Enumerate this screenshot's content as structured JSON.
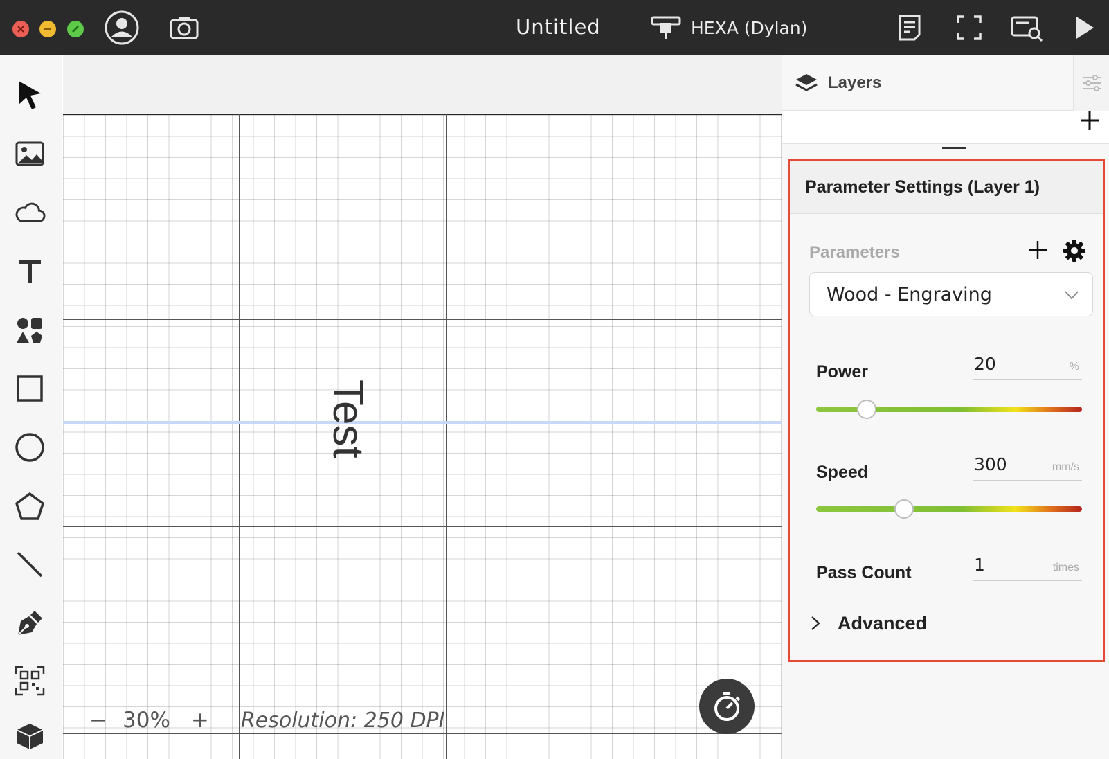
{
  "window": {
    "title": "Untitled",
    "device_name": "HEXA (Dylan)"
  },
  "icons": {
    "traffic_close": "close-icon",
    "traffic_minimize": "minimize-icon",
    "traffic_zoom": "fullscreen-icon",
    "account": "user-icon",
    "camera": "camera-icon",
    "device": "laser-device-icon",
    "document": "document-icon",
    "frame": "frame-icon",
    "preview": "path-preview-icon",
    "run": "play-icon"
  },
  "toolbar": {
    "tools": [
      "select",
      "image",
      "cloud",
      "text",
      "elements",
      "rectangle",
      "ellipse",
      "polygon",
      "line",
      "pen",
      "qr-code",
      "3d-curve"
    ]
  },
  "canvas": {
    "text_object": "Test",
    "zoom_minus": "−",
    "zoom_value": "30%",
    "zoom_plus": "+",
    "resolution": "Resolution: 250 DPI"
  },
  "right_panel": {
    "layers_title": "Layers",
    "param_title": "Parameter Settings (Layer 1)",
    "parameters_label": "Parameters",
    "preset": "Wood - Engraving",
    "fields": {
      "power": {
        "label": "Power",
        "value": "20",
        "unit": "%",
        "slider_fraction": 0.19
      },
      "speed": {
        "label": "Speed",
        "value": "300",
        "unit": "mm/s",
        "slider_fraction": 0.33
      },
      "pass_count": {
        "label": "Pass Count",
        "value": "1",
        "unit": "times"
      }
    },
    "advanced_label": "Advanced"
  },
  "colors": {
    "titlebar": "#2a2a2a",
    "highlight_border": "#e54b34",
    "guide_line": "#c8d8f8"
  }
}
